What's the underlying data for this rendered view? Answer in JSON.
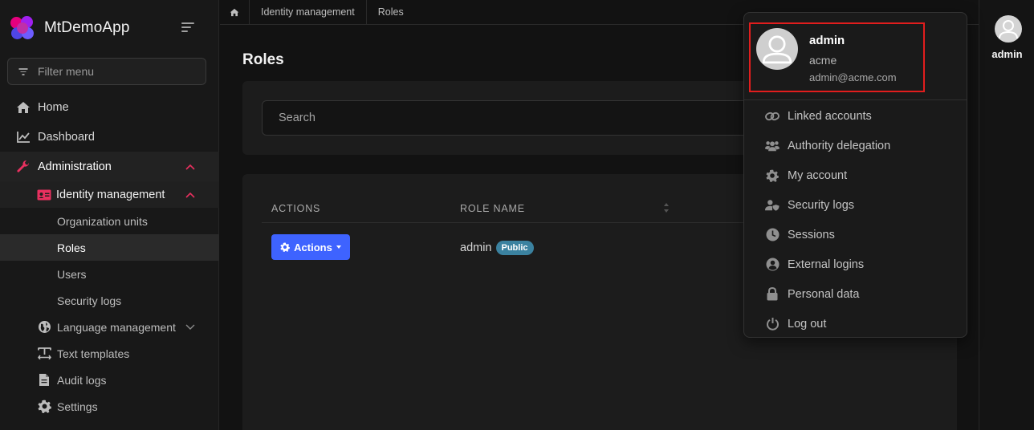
{
  "app": {
    "name": "MtDemoApp"
  },
  "sidebar": {
    "filter_placeholder": "Filter menu",
    "items": {
      "home": "Home",
      "dashboard": "Dashboard",
      "administration": "Administration",
      "identity_management": "Identity management",
      "organization_units": "Organization units",
      "roles": "Roles",
      "users": "Users",
      "security_logs": "Security logs",
      "language_management": "Language management",
      "text_templates": "Text templates",
      "audit_logs": "Audit logs",
      "settings": "Settings"
    }
  },
  "breadcrumb": {
    "items": [
      "Identity management",
      "Roles"
    ]
  },
  "page": {
    "title": "Roles"
  },
  "search": {
    "placeholder": "Search"
  },
  "table": {
    "columns": [
      "ACTIONS",
      "ROLE NAME"
    ],
    "rows": [
      {
        "actions_label": "Actions",
        "role_name": "admin",
        "badge": "Public"
      }
    ]
  },
  "user": {
    "name": "admin",
    "tenant": "acme",
    "email": "admin@acme.com"
  },
  "user_menu": {
    "items": [
      "Linked accounts",
      "Authority delegation",
      "My account",
      "Security logs",
      "Sessions",
      "External logins",
      "Personal data",
      "Log out"
    ]
  },
  "colors": {
    "accent": "#e8305f",
    "primary_button": "#3e63ff",
    "badge": "#3b82a0",
    "highlight_border": "#e11d1d"
  },
  "icons": [
    "home-icon",
    "chart-line-icon",
    "wrench-icon",
    "id-card-icon",
    "globe-icon",
    "text-template-icon",
    "file-icon",
    "gear-icon",
    "link-icon",
    "users-icon",
    "user-shield-icon",
    "clock-icon",
    "user-circle-icon",
    "lock-icon",
    "power-icon"
  ]
}
